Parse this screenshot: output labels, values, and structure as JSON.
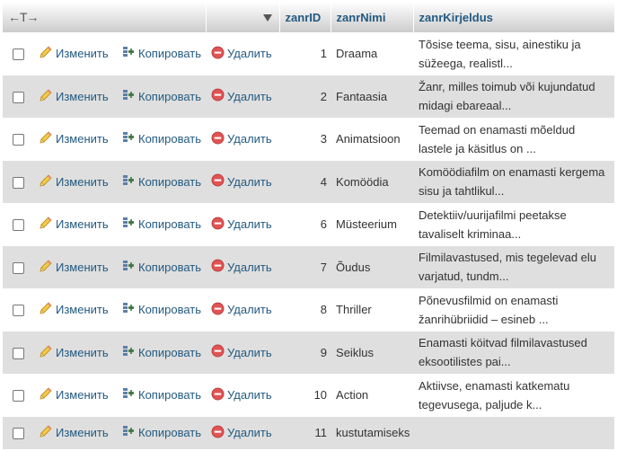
{
  "header": {
    "arrows": "←T→",
    "col_id": "zanrID",
    "col_name": "zanrNimi",
    "col_desc": "zanrKirjeldus"
  },
  "actions": {
    "edit": "Изменить",
    "copy": "Копировать",
    "delete": "Удалить"
  },
  "rows": [
    {
      "id": "1",
      "name": "Draama",
      "desc1": "Tõsise teema, sisu, ainestiku ja",
      "desc2": "süžeega, realistl..."
    },
    {
      "id": "2",
      "name": "Fantaasia",
      "desc1": "Žanr, milles toimub või kujundatud",
      "desc2": "midagi ebareaal..."
    },
    {
      "id": "3",
      "name": "Animatsioon",
      "desc1": "Teemad on enamasti mõeldud",
      "desc2": "lastele ja käsitlus on ..."
    },
    {
      "id": "4",
      "name": "Komöödia",
      "desc1": "Komöödiafilm on enamasti kergema",
      "desc2": "sisu ja tahtlikul..."
    },
    {
      "id": "6",
      "name": "Müsteerium",
      "desc1": "Detektiiv/uurijafilmi peetakse",
      "desc2": "tavaliselt kriminaa..."
    },
    {
      "id": "7",
      "name": "Õudus",
      "desc1": "Filmilavastused, mis tegelevad elu",
      "desc2": "varjatud, tundm..."
    },
    {
      "id": "8",
      "name": "Thriller",
      "desc1": "Põnevusfilmid on enamasti",
      "desc2": "žanrihübriidid – esineb ..."
    },
    {
      "id": "9",
      "name": "Seiklus",
      "desc1": "Enamasti köitvad filmilavastused",
      "desc2": "eksootilistes pai..."
    },
    {
      "id": "10",
      "name": "Action",
      "desc1": "Aktiivse, enamasti katkematu",
      "desc2": "tegevusega, paljude k..."
    },
    {
      "id": "11",
      "name": "kustutamiseks",
      "desc1": "",
      "desc2": ""
    }
  ]
}
